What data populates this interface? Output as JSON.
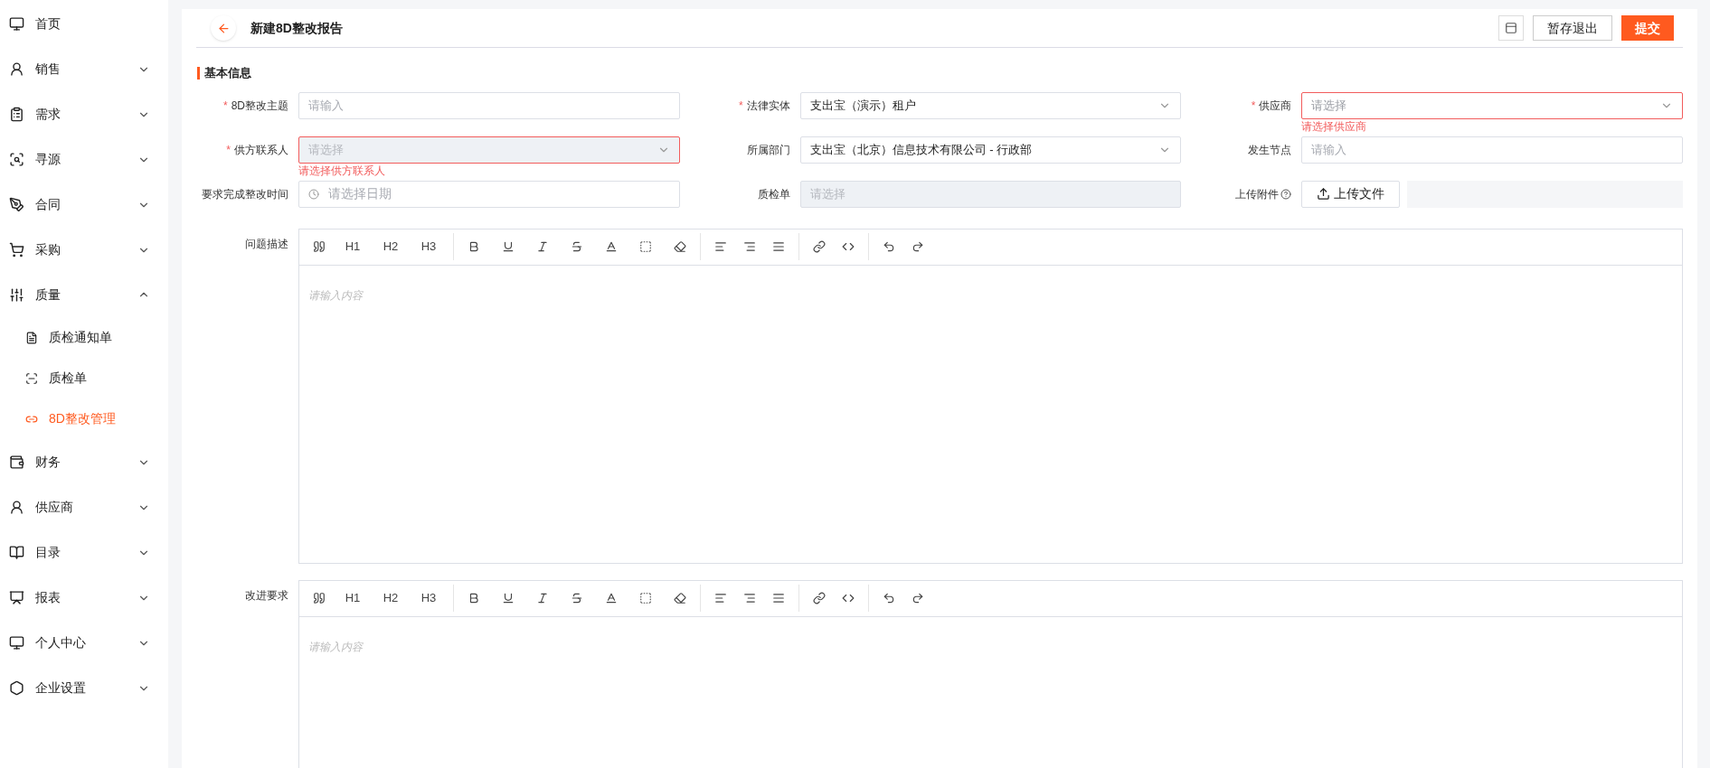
{
  "sidebar": {
    "items": [
      {
        "label": "首页",
        "kind": "link"
      },
      {
        "label": "销售",
        "kind": "group",
        "expanded": false
      },
      {
        "label": "需求",
        "kind": "group",
        "expanded": false
      },
      {
        "label": "寻源",
        "kind": "group",
        "expanded": false
      },
      {
        "label": "合同",
        "kind": "group",
        "expanded": false
      },
      {
        "label": "采购",
        "kind": "group",
        "expanded": false
      },
      {
        "label": "质量",
        "kind": "group",
        "expanded": true,
        "children": [
          {
            "label": "质检通知单",
            "selected": false
          },
          {
            "label": "质检单",
            "selected": false
          },
          {
            "label": "8D整改管理",
            "selected": true
          }
        ]
      },
      {
        "label": "财务",
        "kind": "group",
        "expanded": false
      },
      {
        "label": "供应商",
        "kind": "group",
        "expanded": false
      },
      {
        "label": "目录",
        "kind": "group",
        "expanded": false
      },
      {
        "label": "报表",
        "kind": "group",
        "expanded": false
      },
      {
        "label": "个人中心",
        "kind": "group",
        "expanded": false
      },
      {
        "label": "企业设置",
        "kind": "group",
        "expanded": false
      }
    ]
  },
  "header": {
    "title": "新建8D整改报告",
    "buttons": [
      {
        "label": "暂存退出",
        "primary": false
      },
      {
        "label": "提交",
        "primary": true
      }
    ]
  },
  "section": {
    "title": "基本信息"
  },
  "fields": [
    {
      "label": "8D整改主题",
      "required_mark": "*",
      "kind": "input",
      "placeholder": "请输入"
    },
    {
      "label": "法律实体",
      "required_mark": "*",
      "kind": "select",
      "value": "支出宝（演示）租户",
      "disabled": false
    },
    {
      "label": "供应商",
      "required_mark": "*",
      "kind": "select",
      "placeholder": "请选择",
      "disabled": false,
      "error": "请选择供应商"
    },
    {
      "label": "供方联系人",
      "required_mark": "*",
      "kind": "select",
      "placeholder": "请选择",
      "disabled": true,
      "error": "请选择供方联系人"
    },
    {
      "label": "所属部门",
      "kind": "select",
      "value": "支出宝（北京）信息技术有限公司 - 行政部",
      "disabled": false
    },
    {
      "label": "发生节点",
      "kind": "input",
      "placeholder": "请输入"
    },
    {
      "label": "要求完成整改时间",
      "kind": "date",
      "placeholder": "请选择日期"
    },
    {
      "label": "质检单",
      "kind": "select",
      "placeholder": "请选择",
      "disabled": true
    },
    {
      "label": "上传附件",
      "kind": "upload",
      "button": "上传文件"
    }
  ],
  "editors": [
    {
      "label": "问题描述",
      "placeholder": "请输入内容",
      "headings": [
        "H1",
        "H2",
        "H3"
      ]
    },
    {
      "label": "改进要求",
      "placeholder": "请输入内容",
      "headings": [
        "H1",
        "H2",
        "H3"
      ]
    }
  ]
}
